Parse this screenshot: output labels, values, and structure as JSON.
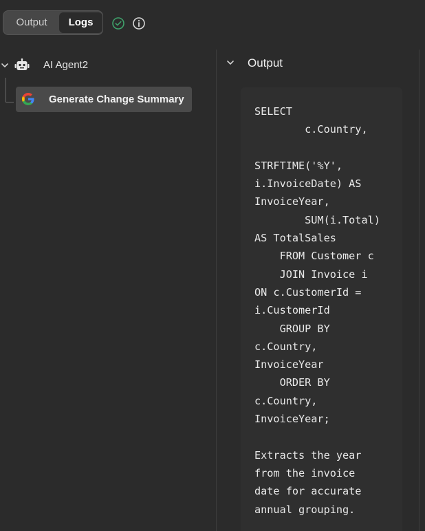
{
  "tabs": {
    "output_label": "Output",
    "logs_label": "Logs",
    "active": "Logs"
  },
  "tree": {
    "agent_label": "AI Agent2",
    "child_label": "Generate Change Summary"
  },
  "output_panel": {
    "title": "Output",
    "content": "SELECT\n        c.Country,\n\nSTRFTIME('%Y',\ni.InvoiceDate) AS\nInvoiceYear,\n        SUM(i.Total)\nAS TotalSales\n    FROM Customer c\n    JOIN Invoice i\nON c.CustomerId =\ni.CustomerId\n    GROUP BY\nc.Country,\nInvoiceYear\n    ORDER BY\nc.Country,\nInvoiceYear;\n\nExtracts the year\nfrom the invoice\ndate for accurate\nannual grouping."
  },
  "colors": {
    "success_green": "#3fa26b",
    "background": "#2b2b2b",
    "tab_bar": "#474747",
    "selected_item": "#4a4a4a"
  },
  "icons": {
    "status_success": "check-circle-icon",
    "info": "info-icon",
    "agent": "robot-icon",
    "child": "google-icon"
  }
}
